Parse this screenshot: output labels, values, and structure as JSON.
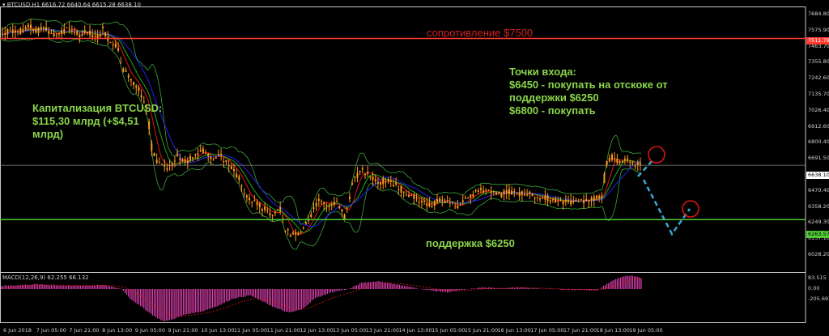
{
  "header": {
    "symbol": "BTCUSD,H1",
    "ohlc": "6616.72 6640.64 6615.28 6638.10",
    "arrow_icon": "triangle-down-icon"
  },
  "macd": {
    "label": "MACD(12,26,9) 62.255 66.132"
  },
  "annotations": {
    "resistance": "сопротивление $7500",
    "support": "поддержка $6250",
    "cap": "Капитализация BTCUSD:\n$115,30 млрд (+$4,51\nмлрд)",
    "entry": "Точки входа:\n$6450 - покупать на отскоке от\nподдержки $6250\n$6800 - покупать"
  },
  "colors": {
    "resistance_line": "#ff3b30",
    "support_line": "#4dcc33",
    "annotation_green": "#8ad44a",
    "annotation_red": "#d42020",
    "candles": "#ff9a1a",
    "macd_hist": "#e040b0",
    "ma_red": "#e11515",
    "ma_blue": "#2222ee",
    "ma_green": "#1ea81e",
    "bands": "#3ca53c",
    "projection": "#39a7d8"
  },
  "price_tags": {
    "resistance": "7511.78",
    "current": "6638.10",
    "support": "6263.57"
  },
  "y_axis": [
    "7684.80",
    "7575.90",
    "7463.70",
    "7355.80",
    "7242.60",
    "7135.70",
    "7026.40",
    "6912.60",
    "6800.40",
    "6691.50",
    "6579.30",
    "6470.40",
    "6358.20",
    "6249.30",
    "6137.10",
    "6028.20"
  ],
  "macd_axis": [
    "83.515",
    "0.00",
    "-205.69"
  ],
  "x_axis": [
    "6 Jun 2018",
    "7 Jun 05:00",
    "7 Jun 21:00",
    "8 Jun 13:00",
    "9 Jun 05:00",
    "9 Jun 21:00",
    "10 Jun 13:00",
    "11 Jun 05:00",
    "11 Jun 21:00",
    "12 Jun 13:00",
    "13 Jun 05:00",
    "13 Jun 21:00",
    "14 Jun 13:00",
    "15 Jun 05:00",
    "15 Jun 21:00",
    "16 Jun 13:00",
    "17 Jun 05:00",
    "17 Jun 21:00",
    "18 Jun 13:00",
    "19 Jun 05:00"
  ],
  "chart_data": {
    "type": "candlestick",
    "symbol": "BTCUSD",
    "timeframe": "H1",
    "ylim": [
      6028.2,
      7684.8
    ],
    "levels": {
      "resistance": 7511.78,
      "support": 6263.57,
      "current": 6638.1
    },
    "close_path": [
      [
        0,
        7540
      ],
      [
        10,
        7570
      ],
      [
        20,
        7555
      ],
      [
        30,
        7600
      ],
      [
        40,
        7560
      ],
      [
        50,
        7590
      ],
      [
        60,
        7530
      ],
      [
        70,
        7560
      ],
      [
        80,
        7580
      ],
      [
        90,
        7540
      ],
      [
        100,
        7560
      ],
      [
        110,
        7510
      ],
      [
        118,
        7580
      ],
      [
        125,
        7500
      ],
      [
        135,
        7460
      ],
      [
        140,
        7300
      ],
      [
        150,
        7250
      ],
      [
        160,
        7150
      ],
      [
        170,
        7000
      ],
      [
        175,
        6720
      ],
      [
        185,
        6640
      ],
      [
        195,
        6620
      ],
      [
        205,
        6700
      ],
      [
        215,
        6650
      ],
      [
        225,
        6720
      ],
      [
        235,
        6740
      ],
      [
        245,
        6690
      ],
      [
        255,
        6700
      ],
      [
        265,
        6640
      ],
      [
        275,
        6560
      ],
      [
        285,
        6420
      ],
      [
        295,
        6380
      ],
      [
        305,
        6340
      ],
      [
        315,
        6300
      ],
      [
        325,
        6350
      ],
      [
        330,
        6200
      ],
      [
        340,
        6150
      ],
      [
        350,
        6180
      ],
      [
        360,
        6300
      ],
      [
        370,
        6420
      ],
      [
        380,
        6350
      ],
      [
        390,
        6390
      ],
      [
        400,
        6280
      ],
      [
        410,
        6550
      ],
      [
        420,
        6600
      ],
      [
        430,
        6560
      ],
      [
        440,
        6520
      ],
      [
        450,
        6540
      ],
      [
        460,
        6500
      ],
      [
        470,
        6450
      ],
      [
        480,
        6420
      ],
      [
        490,
        6380
      ],
      [
        500,
        6360
      ],
      [
        510,
        6400
      ],
      [
        520,
        6380
      ],
      [
        530,
        6350
      ],
      [
        540,
        6420
      ],
      [
        550,
        6440
      ],
      [
        560,
        6470
      ],
      [
        570,
        6450
      ],
      [
        580,
        6430
      ],
      [
        590,
        6460
      ],
      [
        600,
        6440
      ],
      [
        610,
        6450
      ],
      [
        620,
        6430
      ],
      [
        630,
        6420
      ],
      [
        640,
        6400
      ],
      [
        650,
        6390
      ],
      [
        660,
        6380
      ],
      [
        670,
        6400
      ],
      [
        680,
        6390
      ],
      [
        690,
        6410
      ],
      [
        700,
        6430
      ],
      [
        705,
        6650
      ],
      [
        712,
        6700
      ],
      [
        720,
        6660
      ],
      [
        730,
        6680
      ],
      [
        740,
        6640
      ],
      [
        746,
        6638
      ]
    ],
    "macd_hist": [
      [
        0,
        20
      ],
      [
        40,
        30
      ],
      [
        80,
        20
      ],
      [
        120,
        25
      ],
      [
        140,
        0
      ],
      [
        150,
        -60
      ],
      [
        165,
        -120
      ],
      [
        180,
        -180
      ],
      [
        190,
        -205
      ],
      [
        200,
        -190
      ],
      [
        215,
        -160
      ],
      [
        235,
        -140
      ],
      [
        255,
        -100
      ],
      [
        270,
        -60
      ],
      [
        290,
        -40
      ],
      [
        305,
        -80
      ],
      [
        320,
        -120
      ],
      [
        335,
        -150
      ],
      [
        350,
        -130
      ],
      [
        365,
        -60
      ],
      [
        385,
        -20
      ],
      [
        405,
        0
      ],
      [
        420,
        40
      ],
      [
        440,
        50
      ],
      [
        460,
        30
      ],
      [
        480,
        10
      ],
      [
        500,
        -10
      ],
      [
        520,
        -20
      ],
      [
        540,
        -5
      ],
      [
        560,
        10
      ],
      [
        580,
        5
      ],
      [
        600,
        10
      ],
      [
        620,
        5
      ],
      [
        640,
        0
      ],
      [
        660,
        -5
      ],
      [
        680,
        -5
      ],
      [
        695,
        -10
      ],
      [
        705,
        30
      ],
      [
        715,
        60
      ],
      [
        725,
        80
      ],
      [
        735,
        83
      ],
      [
        746,
        70
      ]
    ]
  }
}
